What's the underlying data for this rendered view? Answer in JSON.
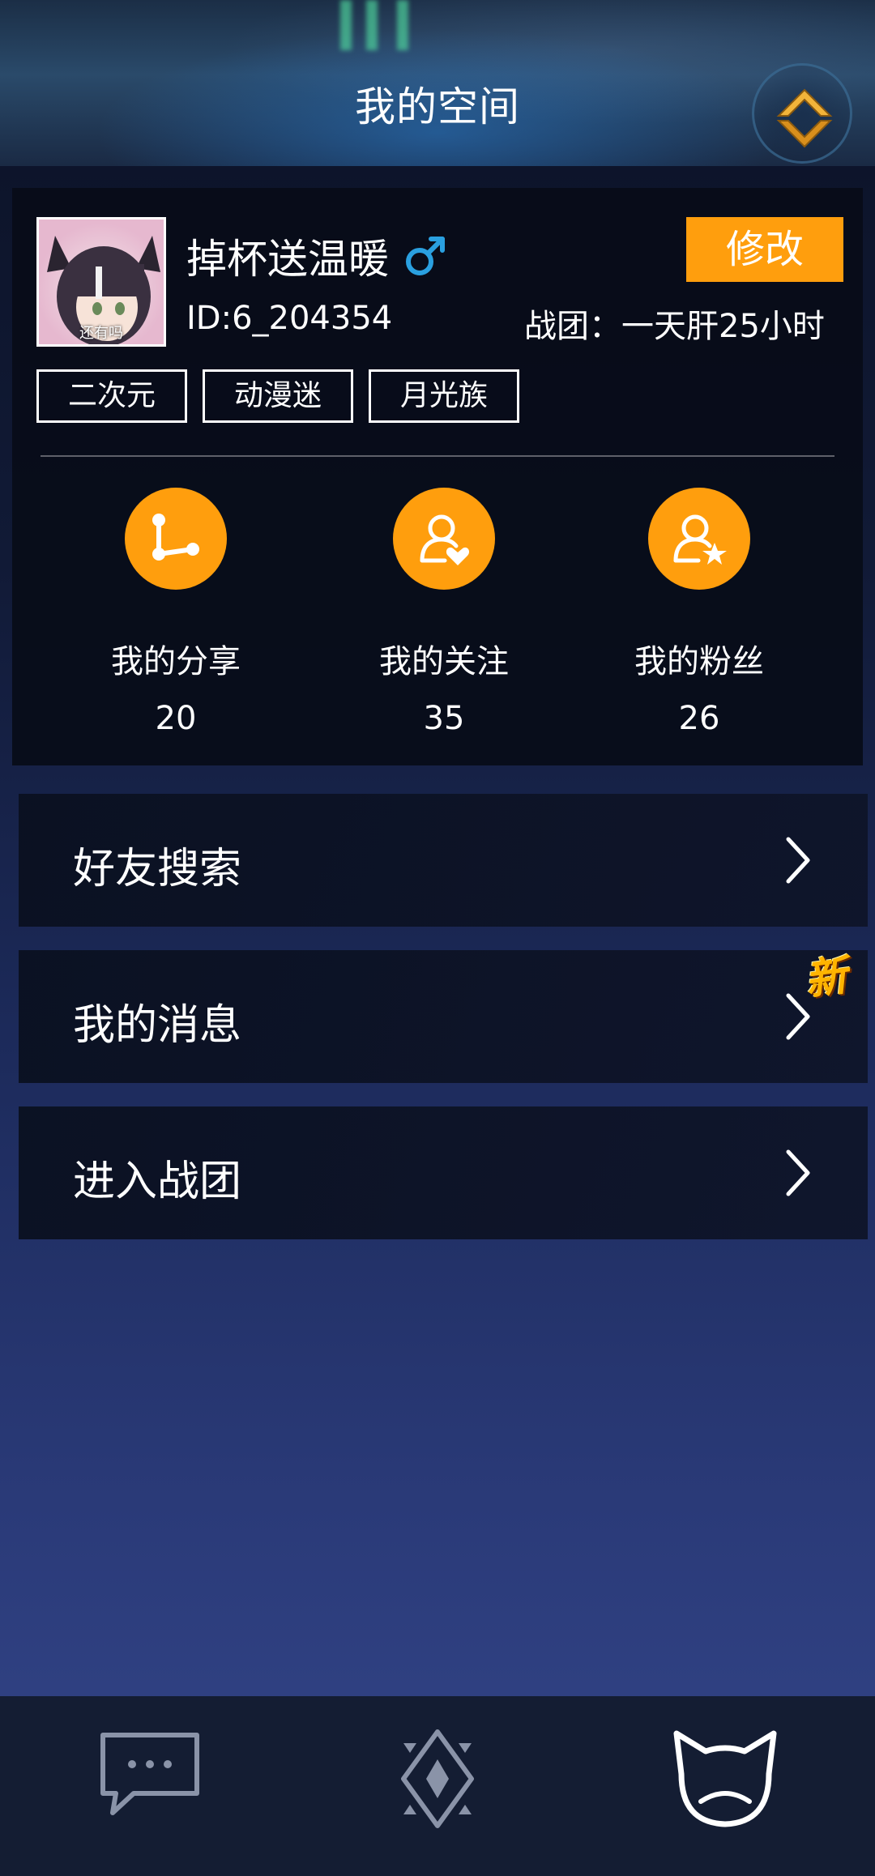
{
  "header": {
    "title": "我的空间"
  },
  "profile": {
    "avatar_label": "还有吗",
    "username": "掉杯送温暖",
    "user_id": "ID:6_204354",
    "team": "战团：一天肝25小时",
    "edit_label": "修改",
    "tags": [
      "二次元",
      "动漫迷",
      "月光族"
    ]
  },
  "stats": [
    {
      "label": "我的分享",
      "value": "20",
      "icon": "share-icon"
    },
    {
      "label": "我的关注",
      "value": "35",
      "icon": "user-heart-icon"
    },
    {
      "label": "我的粉丝",
      "value": "26",
      "icon": "user-star-icon"
    }
  ],
  "menu": [
    {
      "label": "好友搜索"
    },
    {
      "label": "我的消息",
      "badge": "新"
    },
    {
      "label": "进入战团"
    }
  ],
  "colors": {
    "accent": "#ff9e0d",
    "gender": "#2aa0e0"
  },
  "bottom_nav": [
    "chat-icon",
    "diamond-icon",
    "cat-face-icon"
  ]
}
